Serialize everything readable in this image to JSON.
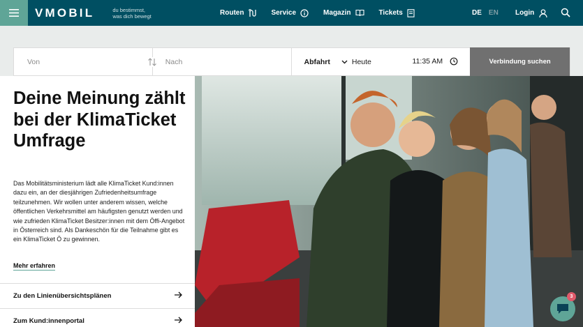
{
  "header": {
    "logo": "VMOBIL",
    "tagline_line1": "du bestimmst,",
    "tagline_line2": "was dich bewegt",
    "nav": [
      {
        "label": "Routen",
        "icon": "route-icon"
      },
      {
        "label": "Service",
        "icon": "info-icon"
      },
      {
        "label": "Magazin",
        "icon": "book-icon"
      },
      {
        "label": "Tickets",
        "icon": "ticket-icon"
      }
    ],
    "lang_de": "DE",
    "lang_en": "EN",
    "login": "Login"
  },
  "search": {
    "from_placeholder": "Von",
    "to_placeholder": "Nach",
    "mode": "Abfahrt",
    "date": "Heute",
    "time": "11:35 AM",
    "button": "Verbindung suchen"
  },
  "teaser": {
    "headline": "Deine Meinung zählt bei der KlimaTicket Umfrage",
    "body": "Das Mobilitätsministerium lädt alle KlimaTicket Kund:innen dazu ein, an der diesjährigen Zufriedenheitsumfrage teilzunehmen. Wir wollen unter anderem wissen, welche öffentlichen Verkehrsmittel am häufigsten genutzt werden und wie zufrieden KlimaTicket Besitzer:innen mit dem Öffi-Angebot in Österreich sind. Als Dankeschön für die Teilnahme gibt es ein KlimaTicket Ö zu gewinnen.",
    "more": "Mehr erfahren"
  },
  "quicklinks": [
    {
      "label": "Zu den Linienübersichtsplänen"
    },
    {
      "label": "Zum Kund:innenportal"
    }
  ],
  "chat": {
    "badge": "3"
  },
  "colors": {
    "header_bg": "#004f62",
    "accent": "#5fa597",
    "button_bg": "#707070",
    "badge": "#e05a6b"
  }
}
